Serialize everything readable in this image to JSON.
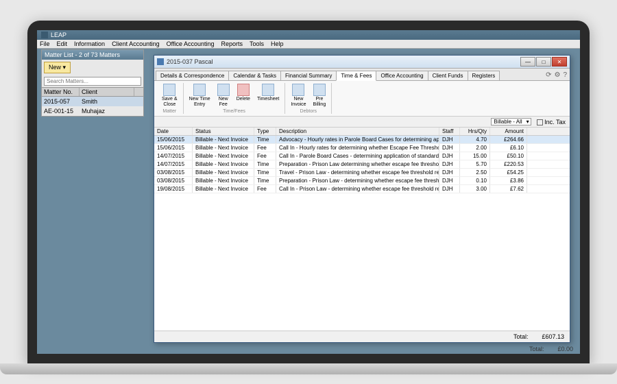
{
  "app": {
    "title": "LEAP"
  },
  "menu": [
    "File",
    "Edit",
    "Information",
    "Client Accounting",
    "Office Accounting",
    "Reports",
    "Tools",
    "Help"
  ],
  "matterPanel": {
    "title": "Matter List - 2 of 73 Matters",
    "newLabel": "New ▾",
    "searchPlaceholder": "Search Matters...",
    "headers": {
      "no": "Matter No.",
      "client": "Client"
    },
    "rows": [
      {
        "no": "2015-057",
        "client": "Smith"
      },
      {
        "no": "AE-001-15",
        "client": "Muhajaz"
      }
    ]
  },
  "dialog": {
    "title": "2015-037 Pascal",
    "tabs": [
      "Details & Correspondence",
      "Calendar & Tasks",
      "Financial Summary",
      "Time & Fees",
      "Office Accounting",
      "Client Funds",
      "Registers"
    ],
    "activeTab": 3,
    "ribbon": {
      "groups": [
        {
          "label": "",
          "buttons": [
            {
              "label": "Save &\nClose",
              "icon": "save"
            }
          ]
        },
        {
          "label": "Matter",
          "buttons": []
        },
        {
          "label": "Time/Fees",
          "buttons": [
            {
              "label": "New Time\nEntry",
              "icon": "clock"
            },
            {
              "label": "New\nFee",
              "icon": "fee"
            },
            {
              "label": "Delete",
              "icon": "delete"
            },
            {
              "label": "Timesheet",
              "icon": "sheet"
            }
          ]
        },
        {
          "label": "Debtors",
          "buttons": [
            {
              "label": "New\nInvoice",
              "icon": "invoice"
            },
            {
              "label": "Pre\nBilling",
              "icon": "prebill"
            }
          ]
        }
      ]
    },
    "filter": {
      "select": "Billable - All",
      "incTax": "Inc. Tax"
    },
    "columns": [
      "Date",
      "Status",
      "Type",
      "Description",
      "Staff",
      "Hrs/Qty",
      "Amount"
    ],
    "rows": [
      {
        "date": "15/06/2015",
        "status": "Billable - Next Invoice",
        "type": "Time",
        "desc": "Advocacy - Hourly rates in Parole Board Cases for determining appli…",
        "staff": "DJH",
        "hrs": "4.70",
        "amt": "£264.66"
      },
      {
        "date": "15/06/2015",
        "status": "Billable - Next Invoice",
        "type": "Fee",
        "desc": "Call In - Hourly rates for determining whether Escape Fee Threshold …",
        "staff": "DJH",
        "hrs": "2.00",
        "amt": "£6.10"
      },
      {
        "date": "14/07/2015",
        "status": "Billable - Next Invoice",
        "type": "Fee",
        "desc": "Call In - Parole Board Cases - determining application of standard f…",
        "staff": "DJH",
        "hrs": "15.00",
        "amt": "£50.10"
      },
      {
        "date": "14/07/2015",
        "status": "Billable - Next Invoice",
        "type": "Time",
        "desc": "Preparation - Prison Law determining whether escape fee threshol…",
        "staff": "DJH",
        "hrs": "5.70",
        "amt": "£220.53"
      },
      {
        "date": "03/08/2015",
        "status": "Billable - Next Invoice",
        "type": "Time",
        "desc": "Travel - Prison Law - determining whether escape fee threshold reac…",
        "staff": "DJH",
        "hrs": "2.50",
        "amt": "£54.25"
      },
      {
        "date": "03/08/2015",
        "status": "Billable - Next Invoice",
        "type": "Time",
        "desc": "Preparation - Prison Law - determining whether escape fee threshol…",
        "staff": "DJH",
        "hrs": "0.10",
        "amt": "£3.86"
      },
      {
        "date": "19/08/2015",
        "status": "Billable - Next Invoice",
        "type": "Fee",
        "desc": "Call In - Prison Law - determining whether escape fee threshold reac…",
        "staff": "DJH",
        "hrs": "3.00",
        "amt": "£7.62"
      }
    ],
    "footer": {
      "totalLabel": "Total:",
      "totalValue": "£607.13"
    }
  },
  "bottomStatus": {
    "total": "Total:",
    "value": "£0.00"
  }
}
